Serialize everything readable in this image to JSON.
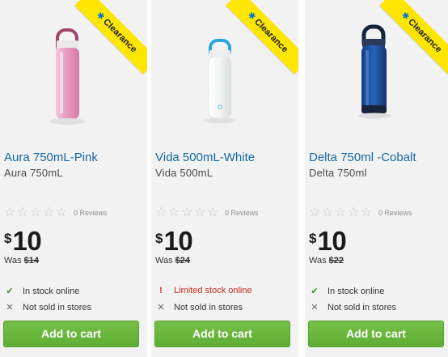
{
  "products": [
    {
      "badge": "Clearance",
      "badge_icon": "spark-icon",
      "title": "Aura 750mL-Pink",
      "subtitle": "Aura 750mL",
      "reviews": "0 Reviews",
      "currency": "$",
      "price": "10",
      "was_label": "Was",
      "was_price": "$14",
      "stock_online": "In stock online",
      "stock_online_status": "ok",
      "stock_store": "Not sold in stores",
      "button": "Add to cart",
      "bottle_color": "#e8a9c8",
      "cap_color": "#b04a70"
    },
    {
      "badge": "Clearance",
      "badge_icon": "spark-icon",
      "title": "Vida 500mL-White",
      "subtitle": "Vida 500mL",
      "reviews": "0 Reviews",
      "currency": "$",
      "price": "10",
      "was_label": "Was",
      "was_price": "$24",
      "stock_online": "Limited stock online",
      "stock_online_status": "warn",
      "stock_store": "Not sold in stores",
      "button": "Add to cart",
      "bottle_color": "#f4f6f7",
      "cap_color": "#2aa7e0"
    },
    {
      "badge": "Clearance",
      "badge_icon": "spark-icon",
      "title": "Delta 750ml -Cobalt",
      "subtitle": "Delta 750ml",
      "reviews": "0 Reviews",
      "currency": "$",
      "price": "10",
      "was_label": "Was",
      "was_price": "$22",
      "stock_online": "In stock online",
      "stock_online_status": "ok",
      "stock_store": "Not sold in stores",
      "button": "Add to cart",
      "bottle_color": "#1f4f9e",
      "cap_color": "#16243e"
    }
  ],
  "colors": {
    "accent_link": "#1467a5",
    "button_green": "#6ab73d",
    "ribbon_yellow": "#ffe600",
    "in_stock_green": "#3e8e27",
    "limited_red": "#c22b1a"
  }
}
